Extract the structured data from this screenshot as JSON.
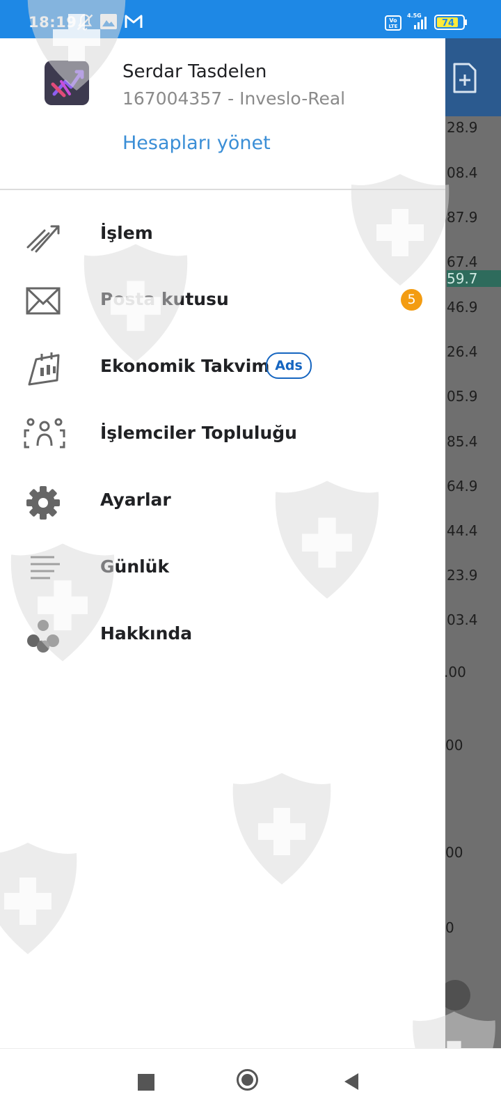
{
  "status_bar": {
    "time": "18:19",
    "icons": [
      "notification-off-icon",
      "gallery-icon",
      "gmail-icon",
      "volte-icon",
      "signal-icon",
      "battery-icon"
    ],
    "network": "4.5G",
    "volte": "Vo LTE",
    "battery": "74"
  },
  "drawer": {
    "user_name": "Serdar Tasdelen",
    "account": "167004357 - Inveslo-Real",
    "manage_accounts": "Hesapları yönet",
    "items": [
      {
        "label": "İşlem",
        "icon": "trade-chart-icon"
      },
      {
        "label": "Posta kutusu",
        "icon": "mail-icon",
        "badge": "5"
      },
      {
        "label": "Ekonomik Takvim",
        "icon": "calendar-icon",
        "tag": "Ads"
      },
      {
        "label": "İşlemciler Topluluğu",
        "icon": "community-icon"
      },
      {
        "label": "Ayarlar",
        "icon": "gear-icon"
      },
      {
        "label": "Günlük",
        "icon": "journal-icon"
      },
      {
        "label": "Hakkında",
        "icon": "about-icon"
      }
    ]
  },
  "background_panel": {
    "values": [
      "28.9",
      "08.4",
      "87.9",
      "67.4",
      "59.7",
      "46.9",
      "26.4",
      "05.9",
      "85.4",
      "64.9",
      "44.4",
      "23.9",
      "03.4",
      ".00",
      "00",
      "00",
      "0"
    ],
    "current_value": "59.7"
  },
  "nav_bar": {
    "buttons": [
      "recents-button",
      "home-button",
      "back-button"
    ]
  },
  "colors": {
    "status_bar": "#1e88e5",
    "link": "#3a8ed6",
    "badge": "#f39c12",
    "ads": "#1565c0"
  }
}
